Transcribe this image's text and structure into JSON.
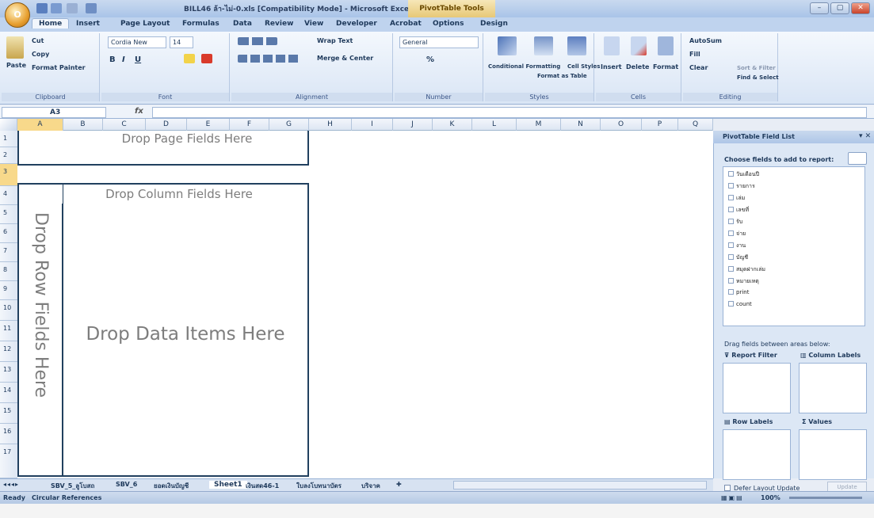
{
  "window": {
    "title": "BILL46 ล้า-ไม่-0.xls [Compatibility Mode] - Microsoft Excel",
    "contextual_tab": "PivotTable Tools",
    "office_button": "O",
    "minimize": "–",
    "restore": "▢",
    "close": "✕"
  },
  "tabs": [
    "Home",
    "Insert",
    "Page Layout",
    "Formulas",
    "Data",
    "Review",
    "View",
    "Developer",
    "Acrobat",
    "Options",
    "Design"
  ],
  "clipboard": {
    "paste": "Paste",
    "cut": "Cut",
    "copy": "Copy",
    "format_painter": "Format Painter",
    "label": "Clipboard"
  },
  "font": {
    "name": "Cordia New",
    "size": "14",
    "label": "Font",
    "bold": "B",
    "italic": "I",
    "underline": "U"
  },
  "alignment": {
    "wrap": "Wrap Text",
    "merge": "Merge & Center",
    "label": "Alignment"
  },
  "number": {
    "format": "General",
    "label": "Number",
    "percent": "%"
  },
  "styles": {
    "conditional": "Conditional Formatting",
    "format_table": "Format as Table",
    "cell_styles": "Cell Styles",
    "label": "Styles"
  },
  "cells": {
    "insert": "Insert",
    "delete": "Delete",
    "format": "Format",
    "label": "Cells"
  },
  "editing": {
    "autosum": "AutoSum",
    "fill": "Fill",
    "clear": "Clear",
    "sort": "Sort & Filter",
    "find": "Find & Select",
    "label": "Editing"
  },
  "formula_bar": {
    "name_box": "A3",
    "fx": "fx",
    "value": ""
  },
  "columns": [
    "A",
    "B",
    "C",
    "D",
    "E",
    "F",
    "G",
    "H",
    "I",
    "J",
    "K",
    "L",
    "M",
    "N",
    "O",
    "P",
    "Q"
  ],
  "rows": [
    "1",
    "2",
    "3",
    "4",
    "5",
    "6",
    "7",
    "8",
    "9",
    "10",
    "11",
    "12",
    "13",
    "14",
    "15",
    "16",
    "17"
  ],
  "pivot": {
    "page": "Drop Page Fields Here",
    "column": "Drop Column Fields Here",
    "row": "Drop Row Fields Here",
    "data": "Drop Data Items Here"
  },
  "field_list": {
    "title": "PivotTable Field List",
    "choose": "Choose fields to add to report:",
    "fields": [
      "วันเดือนปี",
      "รายการ",
      "เล่ม",
      "เลขที่",
      "รับ",
      "จ่าย",
      "งาน",
      "บัญชี",
      "สมุดฝากเล่ม",
      "หมายเหตุ",
      "print",
      "count"
    ],
    "drag": "Drag fields between areas below:",
    "report_filter": "Report Filter",
    "column_labels": "Column Labels",
    "row_labels": "Row Labels",
    "values": "Values",
    "defer": "Defer Layout Update",
    "update": "Update"
  },
  "sheets": [
    "SBV_5_ลูโบสถ",
    "SBV_6",
    "ยอดเงินบัญชี",
    "Sheet1",
    "เงินสด46-1",
    "ใบลงโบทนาบัตร",
    "บริจาค"
  ],
  "status": {
    "ready": "Ready",
    "circular": "Circular References",
    "zoom": "100%"
  }
}
